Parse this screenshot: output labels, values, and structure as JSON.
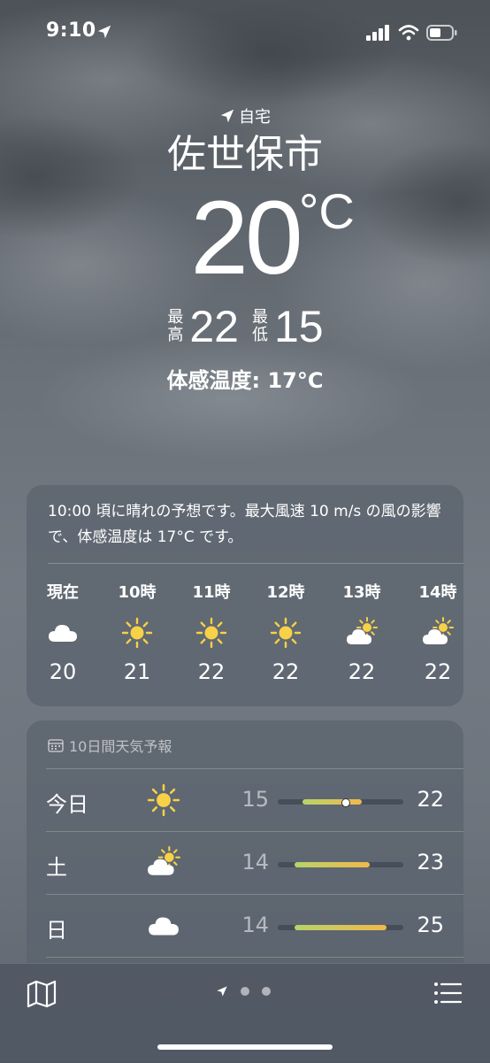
{
  "status_bar": {
    "time": "9:10"
  },
  "header": {
    "home_label": "自宅",
    "city": "佐世保市",
    "temperature": "20",
    "unit": "°C",
    "high_label_1": "最",
    "high_label_2": "高",
    "high": "22",
    "low_label_1": "最",
    "low_label_2": "低",
    "low": "15",
    "feels_like": "体感温度: 17°C"
  },
  "hourly": {
    "summary": "10:00 頃に晴れの予想です。最大風速 10 m/s の風の影響で、体感温度は 17°C です。",
    "items": [
      {
        "label": "現在",
        "icon": "cloud-icon",
        "temp": "20"
      },
      {
        "label": "10時",
        "icon": "sun-icon",
        "temp": "21"
      },
      {
        "label": "11時",
        "icon": "sun-icon",
        "temp": "22"
      },
      {
        "label": "12時",
        "icon": "sun-icon",
        "temp": "22"
      },
      {
        "label": "13時",
        "icon": "partly-sunny-icon",
        "temp": "22"
      },
      {
        "label": "14時",
        "icon": "partly-sunny-icon",
        "temp": "22"
      }
    ]
  },
  "forecast": {
    "title": "10日間天気予報",
    "days": [
      {
        "name": "今日",
        "icon": "sun-icon",
        "low": "15",
        "high": "22",
        "has_now_dot": true
      },
      {
        "name": "土",
        "icon": "partly-sunny-icon",
        "low": "14",
        "high": "23",
        "has_now_dot": false
      },
      {
        "name": "日",
        "icon": "cloud-icon",
        "low": "14",
        "high": "25",
        "has_now_dot": false
      }
    ]
  },
  "colors": {
    "sun": "#f7d147",
    "bar_start": "#b7d36a",
    "bar_end": "#f2b84b"
  }
}
